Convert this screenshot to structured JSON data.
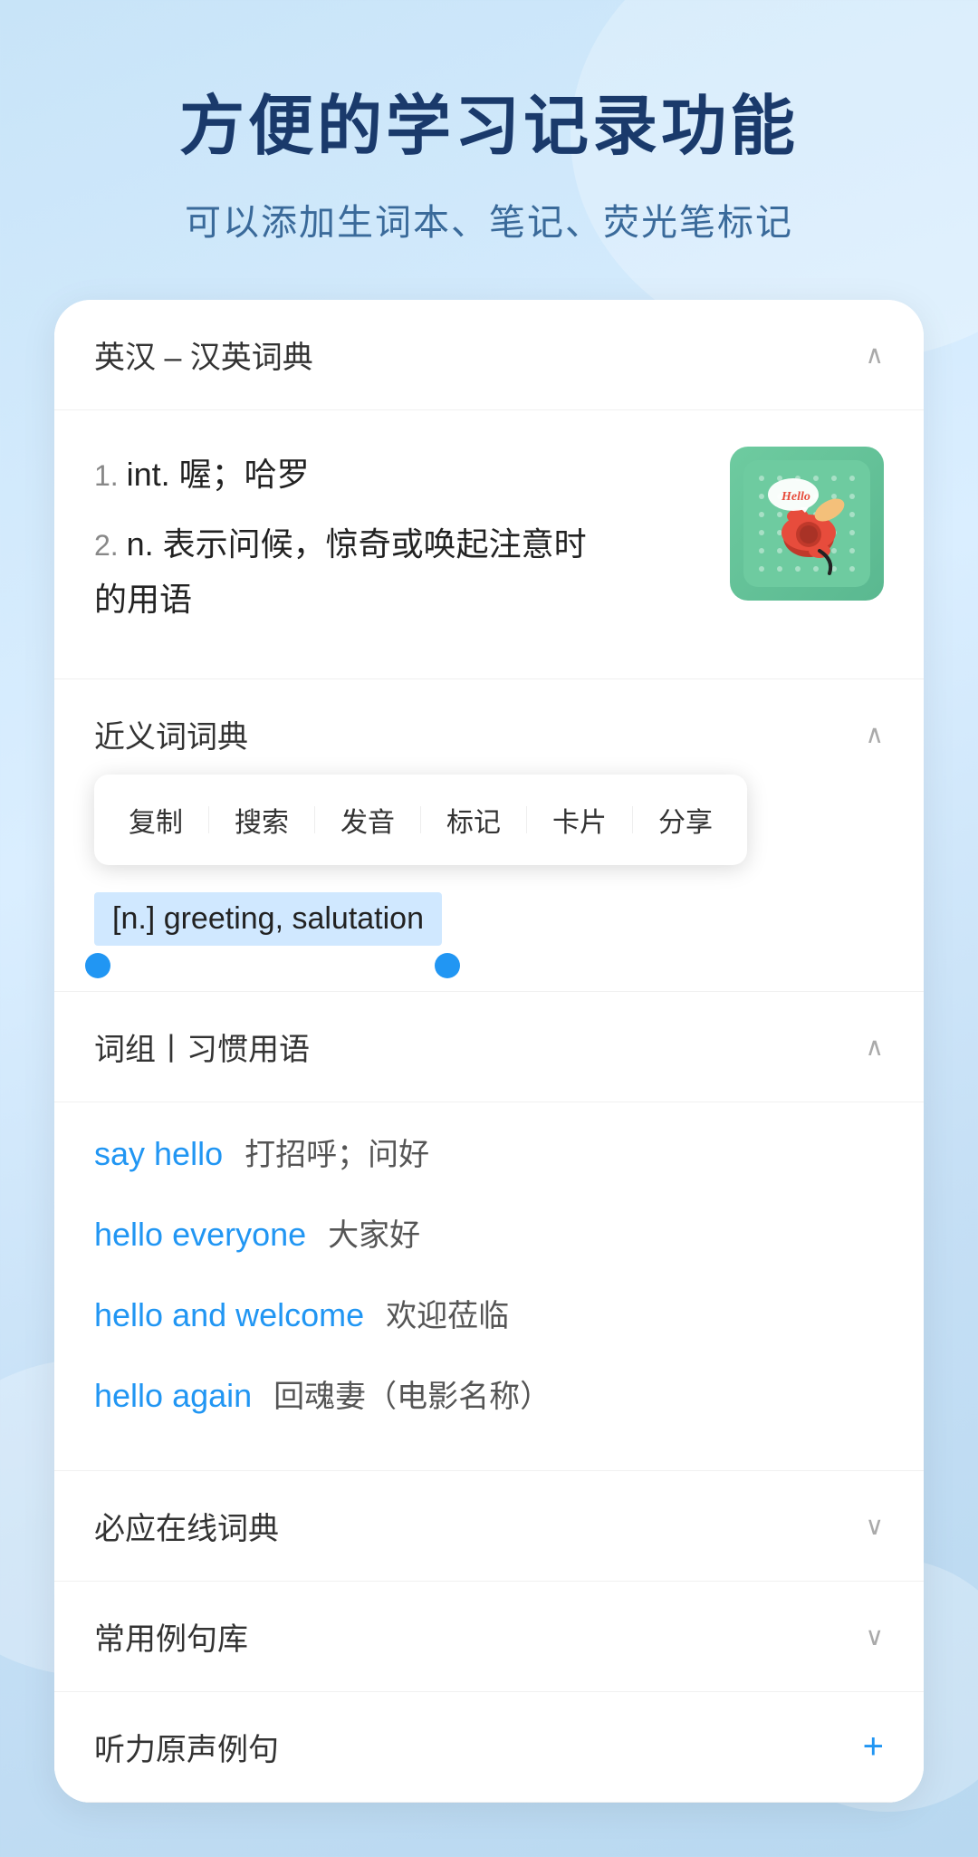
{
  "hero": {
    "title": "方便的学习记录功能",
    "subtitle": "可以添加生词本、笔记、荧光笔标记"
  },
  "dictionary_section": {
    "title": "英汉 – 汉英词典",
    "chevron": "^",
    "definitions": [
      {
        "number": "1.",
        "type": "int.",
        "meaning": "喔；哈罗"
      },
      {
        "number": "2.",
        "type": "n.",
        "meaning": "表示问候，惊奇或唤起注意时的用语"
      }
    ]
  },
  "synonym_section": {
    "title": "近义词词典",
    "chevron": "^",
    "selected_text": "[n.] greeting, salutation"
  },
  "context_menu": {
    "items": [
      "复制",
      "搜索",
      "发音",
      "标记",
      "卡片",
      "分享"
    ]
  },
  "phrases_section": {
    "title": "词组丨习惯用语",
    "chevron": "^",
    "phrases": [
      {
        "en": "say hello",
        "zh": "打招呼；问好"
      },
      {
        "en": "hello everyone",
        "zh": "大家好"
      },
      {
        "en": "hello and welcome",
        "zh": "欢迎莅临"
      },
      {
        "en": "hello again",
        "zh": "回魂妻（电影名称）"
      }
    ]
  },
  "collapsed_sections": [
    {
      "title": "必应在线词典",
      "icon": "chevron-down"
    },
    {
      "title": "常用例句库",
      "icon": "chevron-down"
    },
    {
      "title": "听力原声例句",
      "icon": "plus"
    }
  ]
}
